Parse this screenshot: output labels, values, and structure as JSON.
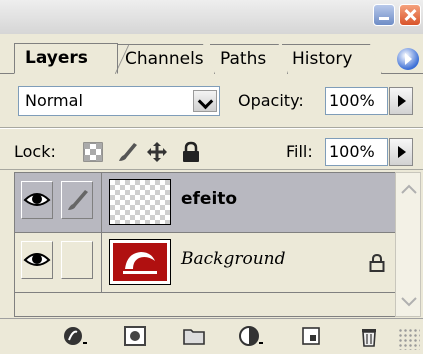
{
  "window": {
    "minimize_icon": "minimize-icon",
    "close_icon": "close-icon"
  },
  "tabs": [
    {
      "label": "Layers",
      "active": true
    },
    {
      "label": "Channels",
      "active": false
    },
    {
      "label": "Paths",
      "active": false
    },
    {
      "label": "History",
      "active": false
    }
  ],
  "blend": {
    "mode": "Normal",
    "opacity_label": "Opacity:",
    "opacity_value": "100%"
  },
  "lock": {
    "label": "Lock:",
    "icons": [
      "lock-transparency-icon",
      "lock-image-icon",
      "lock-position-icon",
      "lock-all-icon"
    ],
    "fill_label": "Fill:",
    "fill_value": "100%"
  },
  "layers": [
    {
      "name": "efeito",
      "selected": true,
      "visible": true,
      "thumbnail": "transparent"
    },
    {
      "name": "Background",
      "selected": false,
      "visible": true,
      "locked": true,
      "thumbnail": "logo"
    }
  ],
  "bottom_toolbar": {
    "icons": [
      "layer-style-icon",
      "layer-mask-icon",
      "new-group-icon",
      "adjustment-layer-icon",
      "new-layer-icon",
      "trash-icon"
    ]
  },
  "colors": {
    "panel_bg": "#ece9d8",
    "selected_row": "#b8b8c0",
    "logo_red": "#b01010"
  }
}
